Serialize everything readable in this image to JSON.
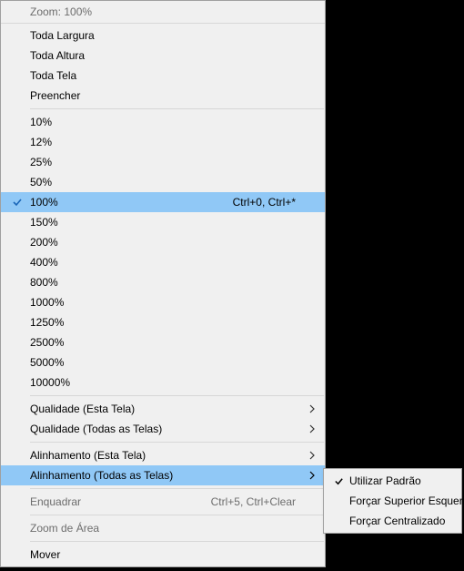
{
  "main_menu": {
    "header": "Zoom: 100%",
    "group1": [
      {
        "label": "Toda Largura"
      },
      {
        "label": "Toda Altura"
      },
      {
        "label": "Toda Tela"
      },
      {
        "label": "Preencher"
      }
    ],
    "group2": [
      {
        "label": "10%"
      },
      {
        "label": "12%"
      },
      {
        "label": "25%"
      },
      {
        "label": "50%"
      },
      {
        "label": "100%",
        "shortcut": "Ctrl+0, Ctrl+*",
        "checked": true,
        "highlighted": true
      },
      {
        "label": "150%"
      },
      {
        "label": "200%"
      },
      {
        "label": "400%"
      },
      {
        "label": "800%"
      },
      {
        "label": "1000%"
      },
      {
        "label": "1250%"
      },
      {
        "label": "2500%"
      },
      {
        "label": "5000%"
      },
      {
        "label": "10000%"
      }
    ],
    "group3": [
      {
        "label": "Qualidade (Esta Tela)",
        "submenu": true
      },
      {
        "label": "Qualidade (Todas as Telas)",
        "submenu": true
      }
    ],
    "group4": [
      {
        "label": "Alinhamento (Esta Tela)",
        "submenu": true
      },
      {
        "label": "Alinhamento (Todas as Telas)",
        "submenu": true,
        "highlighted": true
      }
    ],
    "group5": [
      {
        "label": "Enquadrar",
        "shortcut": "Ctrl+5, Ctrl+Clear",
        "disabled": true
      }
    ],
    "group6": [
      {
        "label": "Zoom de Área",
        "disabled": true
      }
    ],
    "group7": [
      {
        "label": "Mover"
      }
    ]
  },
  "sub_menu": {
    "items": [
      {
        "label": "Utilizar Padrão",
        "checked": true
      },
      {
        "label": "Forçar Superior Esquerdo"
      },
      {
        "label": "Forçar Centralizado"
      }
    ]
  }
}
